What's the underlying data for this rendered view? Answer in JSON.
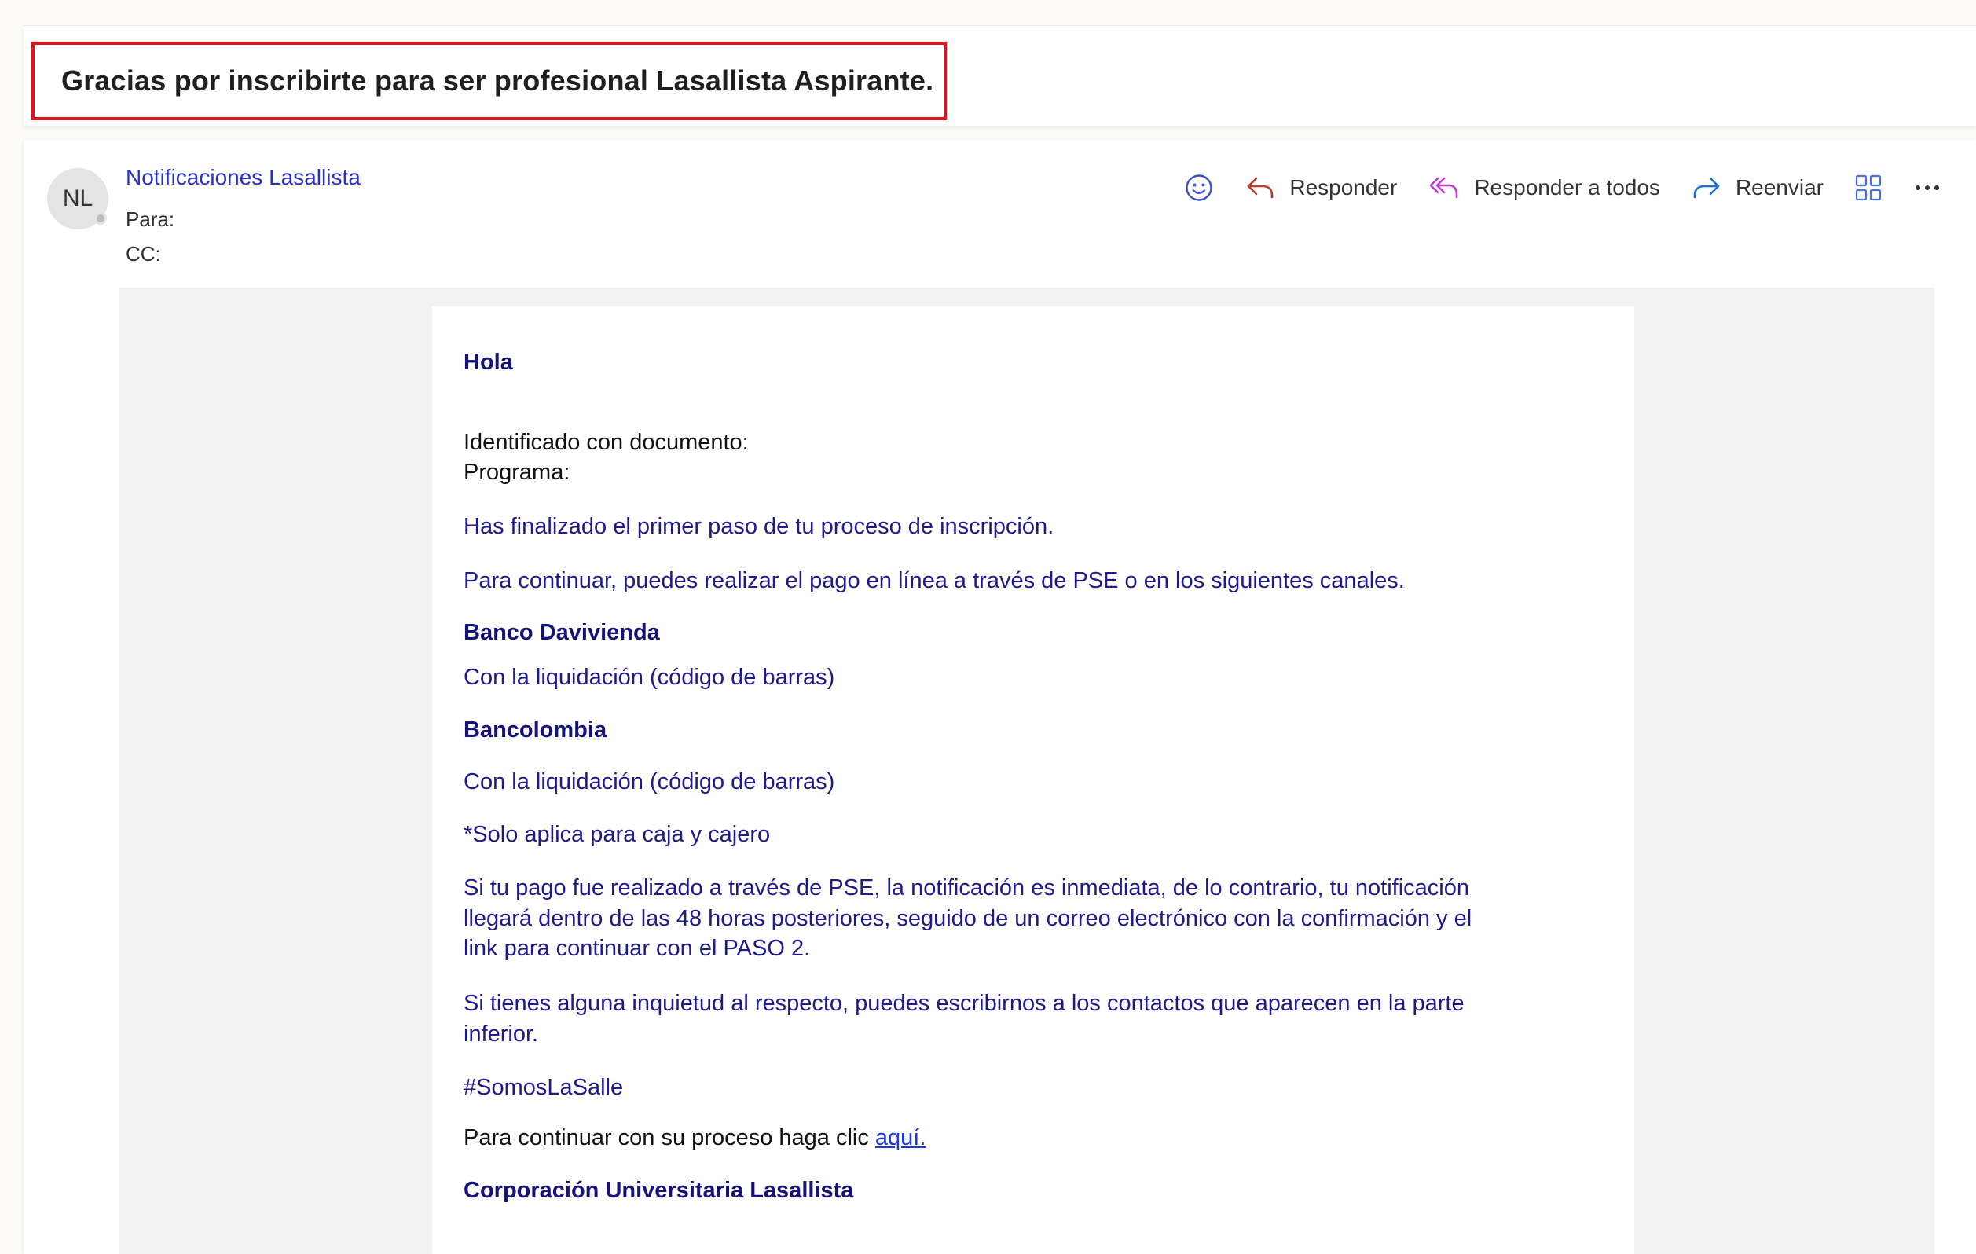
{
  "subject": "Gracias por inscribirte para ser profesional Lasallista Aspirante.",
  "header": {
    "avatar_initials": "NL",
    "sender_name": "Notificaciones Lasallista",
    "to_label": "Para:",
    "cc_label": "CC:"
  },
  "toolbar": {
    "reply_label": "Responder",
    "reply_all_label": "Responder a todos",
    "forward_label": "Reenviar",
    "icons": [
      "smiley-icon",
      "reply-icon",
      "reply-all-icon",
      "forward-icon",
      "apps-grid-icon",
      "more-icon"
    ]
  },
  "body": {
    "greeting": "Hola",
    "document_line": "Identificado con documento:",
    "program_line": "Programa:",
    "step_done": "Has finalizado el primer paso de tu proceso de inscripción.",
    "payment_intro": "Para continuar, puedes realizar el pago en línea a través de PSE o en los siguientes canales.",
    "bank1_name": "Banco Davivienda",
    "bank1_detail": "Con la liquidación (código de barras)",
    "bank2_name": "Bancolombia",
    "bank2_detail": "Con la liquidación (código de barras)",
    "bank2_note": "*Solo aplica para caja y cajero",
    "pse_note_line1": "Si tu pago fue realizado a través de PSE, la notificación es inmediata, de lo contrario, tu notificación",
    "pse_note_line2": "llegará dentro de las 48 horas posteriores, seguido de un correo electrónico con la confirmación y el",
    "pse_note_line3": "link para continuar con el PASO 2.",
    "contact_line1": "Si tienes alguna inquietud al respecto, puedes escribirnos a los contactos que aparecen en la parte",
    "contact_line2": "inferior.",
    "hashtag": "#SomosLaSalle",
    "continue_text": "Para continuar con su proceso haga clic ",
    "continue_link": "aquí.",
    "signature": "Corporación Universitaria Lasallista"
  },
  "colors": {
    "highlight_border": "#e0141e",
    "sender_link": "#2b31c4",
    "body_text": "#1e1a8c",
    "link": "#1a36e8",
    "reply_all_icon": "#c03fd0",
    "forward_icon": "#1f6ed6",
    "grid_icon": "#4a6fe0"
  }
}
